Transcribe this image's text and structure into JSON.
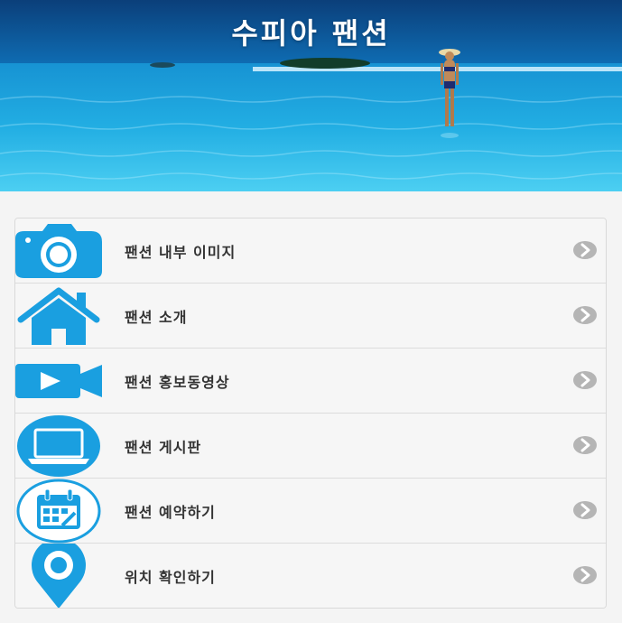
{
  "header": {
    "title": "수피아 팬션"
  },
  "menu": {
    "items": [
      {
        "label": "팬션 내부 이미지",
        "icon": "camera-icon"
      },
      {
        "label": "팬션 소개",
        "icon": "home-icon"
      },
      {
        "label": "팬션 홍보동영상",
        "icon": "video-camera-icon"
      },
      {
        "label": "팬션 게시판",
        "icon": "laptop-icon"
      },
      {
        "label": "팬션 예약하기",
        "icon": "calendar-icon"
      },
      {
        "label": "위치 확인하기",
        "icon": "map-pin-icon"
      }
    ]
  },
  "colors": {
    "icon_blue": "#1a9fe0",
    "chevron_gray": "#b5b5b5",
    "label_text": "#333333"
  }
}
